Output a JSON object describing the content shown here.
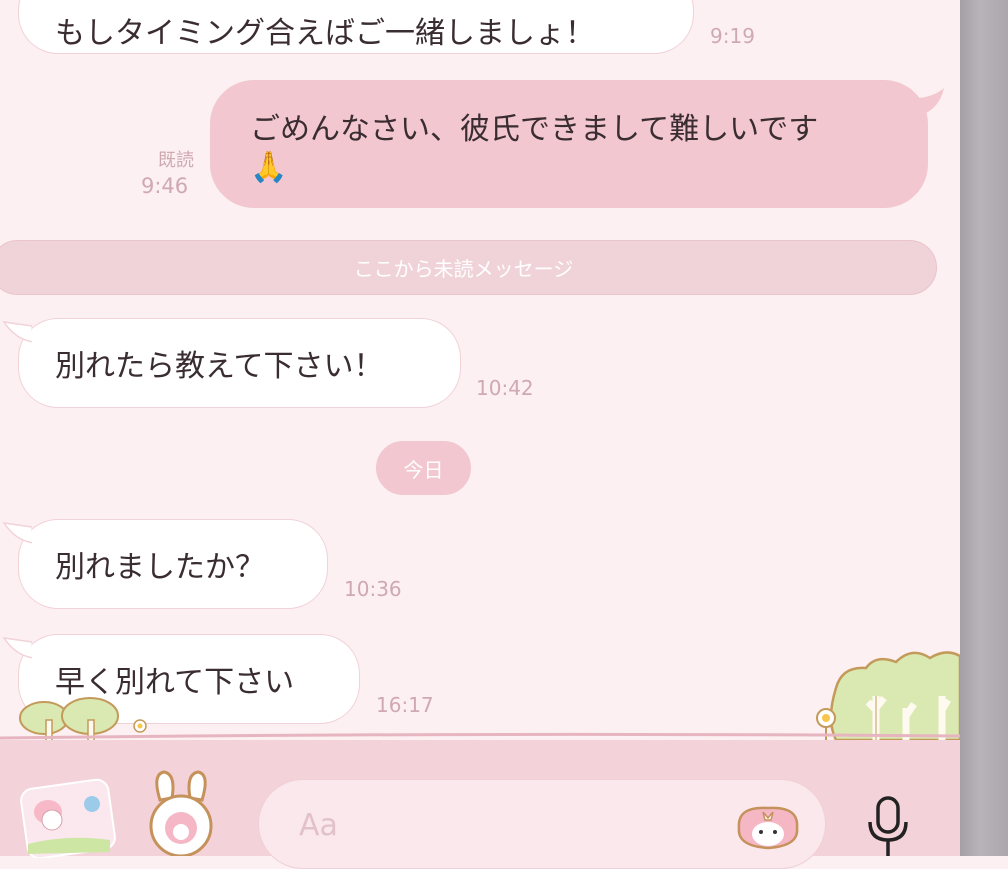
{
  "messages": [
    {
      "side": "received",
      "text": "もしタイミング合えばご一緒しましょ！",
      "time": "9:19"
    },
    {
      "side": "sent",
      "text_line1": "ごめんなさい、彼氏できまして難しいです",
      "text_line2": "🙏",
      "read_label": "既読",
      "time": "9:46"
    },
    {
      "side": "received",
      "text": "別れたら教えて下さい！",
      "time": "10:42"
    },
    {
      "side": "received",
      "text": "別れましたか？",
      "time": "10:36"
    },
    {
      "side": "received",
      "text": "早く別れて下さい",
      "time": "16:17"
    }
  ],
  "unread_divider": "ここから未読メッセージ",
  "date_chip": "今日",
  "input": {
    "placeholder": "Aa"
  },
  "icons": {
    "sticker_button": "melody-sticker-icon",
    "emoji_button": "melody-bunny-emoji-icon",
    "input_sticker": "melody-face-icon",
    "mic": "microphone-icon"
  },
  "colors": {
    "background": "#fcf0f2",
    "sent_bubble": "#f2c7d0",
    "received_bubble": "#ffffff",
    "timestamp": "#cfa9b1",
    "input_bar": "#f4d2d9"
  }
}
